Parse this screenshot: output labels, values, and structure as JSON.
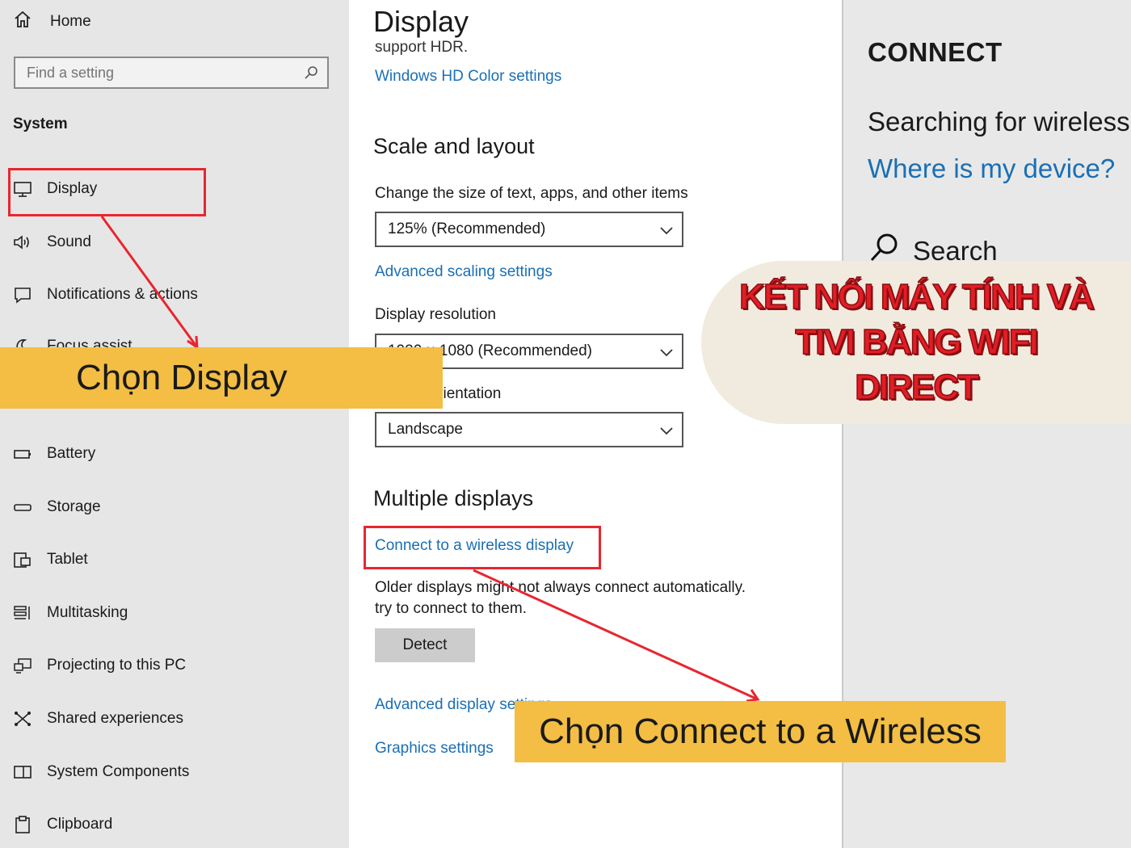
{
  "sidebar": {
    "home_label": "Home",
    "search_placeholder": "Find a setting",
    "section_title": "System",
    "items": [
      {
        "label": "Display",
        "icon": "monitor-icon"
      },
      {
        "label": "Sound",
        "icon": "speaker-icon"
      },
      {
        "label": "Notifications & actions",
        "icon": "notification-icon"
      },
      {
        "label": "Focus assist",
        "icon": "moon-icon"
      },
      {
        "label": "Battery",
        "icon": "battery-icon"
      },
      {
        "label": "Storage",
        "icon": "storage-icon"
      },
      {
        "label": "Tablet",
        "icon": "tablet-icon"
      },
      {
        "label": "Multitasking",
        "icon": "multitasking-icon"
      },
      {
        "label": "Projecting to this PC",
        "icon": "projecting-icon"
      },
      {
        "label": "Shared experiences",
        "icon": "shared-icon"
      },
      {
        "label": "System Components",
        "icon": "components-icon"
      },
      {
        "label": "Clipboard",
        "icon": "clipboard-icon"
      }
    ]
  },
  "main": {
    "title": "Display",
    "hdr_clip_text": "support HDR.",
    "hdr_link": "Windows HD Color settings",
    "scale_heading": "Scale and layout",
    "scale_label": "Change the size of text, apps, and other items",
    "scale_value": "125% (Recommended)",
    "advanced_scaling_link": "Advanced scaling settings",
    "resolution_label": "Display resolution",
    "resolution_value": "1920 × 1080 (Recommended)",
    "orientation_label": "Display orientation",
    "orientation_value": "Landscape",
    "multi_heading": "Multiple displays",
    "wireless_link": "Connect to a wireless display",
    "older_text_1": "Older displays might not always connect automatically.",
    "older_text_2": "try to connect to them.",
    "detect_label": "Detect",
    "advanced_display_link": "Advanced display settings",
    "graphics_link": "Graphics settings"
  },
  "connect_panel": {
    "title": "CONNECT",
    "status": "Searching for wireless",
    "where_link": "Where is my device?",
    "search_label": "Search"
  },
  "overlays": {
    "callout_display": "Chọn  Display",
    "callout_wireless": "Chọn Connect to a Wireless",
    "title_line1": "KẾT NỐI MÁY TÍNH VÀ",
    "title_line2": "TIVI BẰNG WIFI",
    "title_line3": "DIRECT",
    "highlight_color": "#e8262f",
    "callout_color": "#f3be43"
  }
}
